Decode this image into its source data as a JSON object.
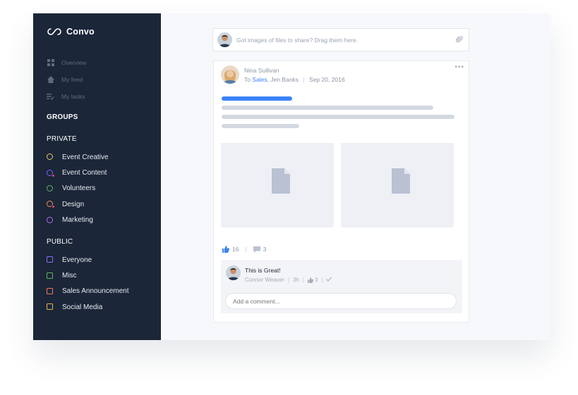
{
  "app": {
    "name": "Convo"
  },
  "sidebar": {
    "nav": [
      {
        "label": "Overview",
        "icon": "grid-icon"
      },
      {
        "label": "My feed",
        "icon": "home-icon"
      },
      {
        "label": "My tasks",
        "icon": "tasks-icon"
      }
    ],
    "groups_title": "GROUPS",
    "private_title": "PRIVATE",
    "private_groups": [
      {
        "label": "Event Creative",
        "color": "#e9c46a",
        "badge": false
      },
      {
        "label": "Event Content",
        "color": "#7b61ff",
        "badge": true
      },
      {
        "label": "Volunteers",
        "color": "#5cb85c",
        "badge": false
      },
      {
        "label": "Design",
        "color": "#f08b5b",
        "badge": true
      },
      {
        "label": "Marketing",
        "color": "#b36bf0",
        "badge": false
      }
    ],
    "public_title": "PUBLIC",
    "public_groups": [
      {
        "label": "Everyone",
        "color": "#8b6ef5"
      },
      {
        "label": "Misc",
        "color": "#5cb85c"
      },
      {
        "label": "Sales Announcement",
        "color": "#f07b5b"
      },
      {
        "label": "Social Media",
        "color": "#e9b44a"
      }
    ]
  },
  "share": {
    "placeholder": "Got images of files to share? Drag them here."
  },
  "post": {
    "author": "Nina Sullivan",
    "to_label": "To",
    "to_group": "Sales",
    "to_person": "Jen Banks",
    "date": "Sep 20, 2016",
    "likes": "16",
    "comment_count": "3"
  },
  "comment": {
    "text": "This is Great!",
    "author": "Connor Weaver",
    "time": "3h",
    "likes": "3"
  },
  "comment_input": {
    "placeholder": "Add a comment..."
  },
  "colors": {
    "sidebar_bg": "#1b2638",
    "accent": "#3b82f6",
    "skeleton": "#d3d8e2"
  }
}
